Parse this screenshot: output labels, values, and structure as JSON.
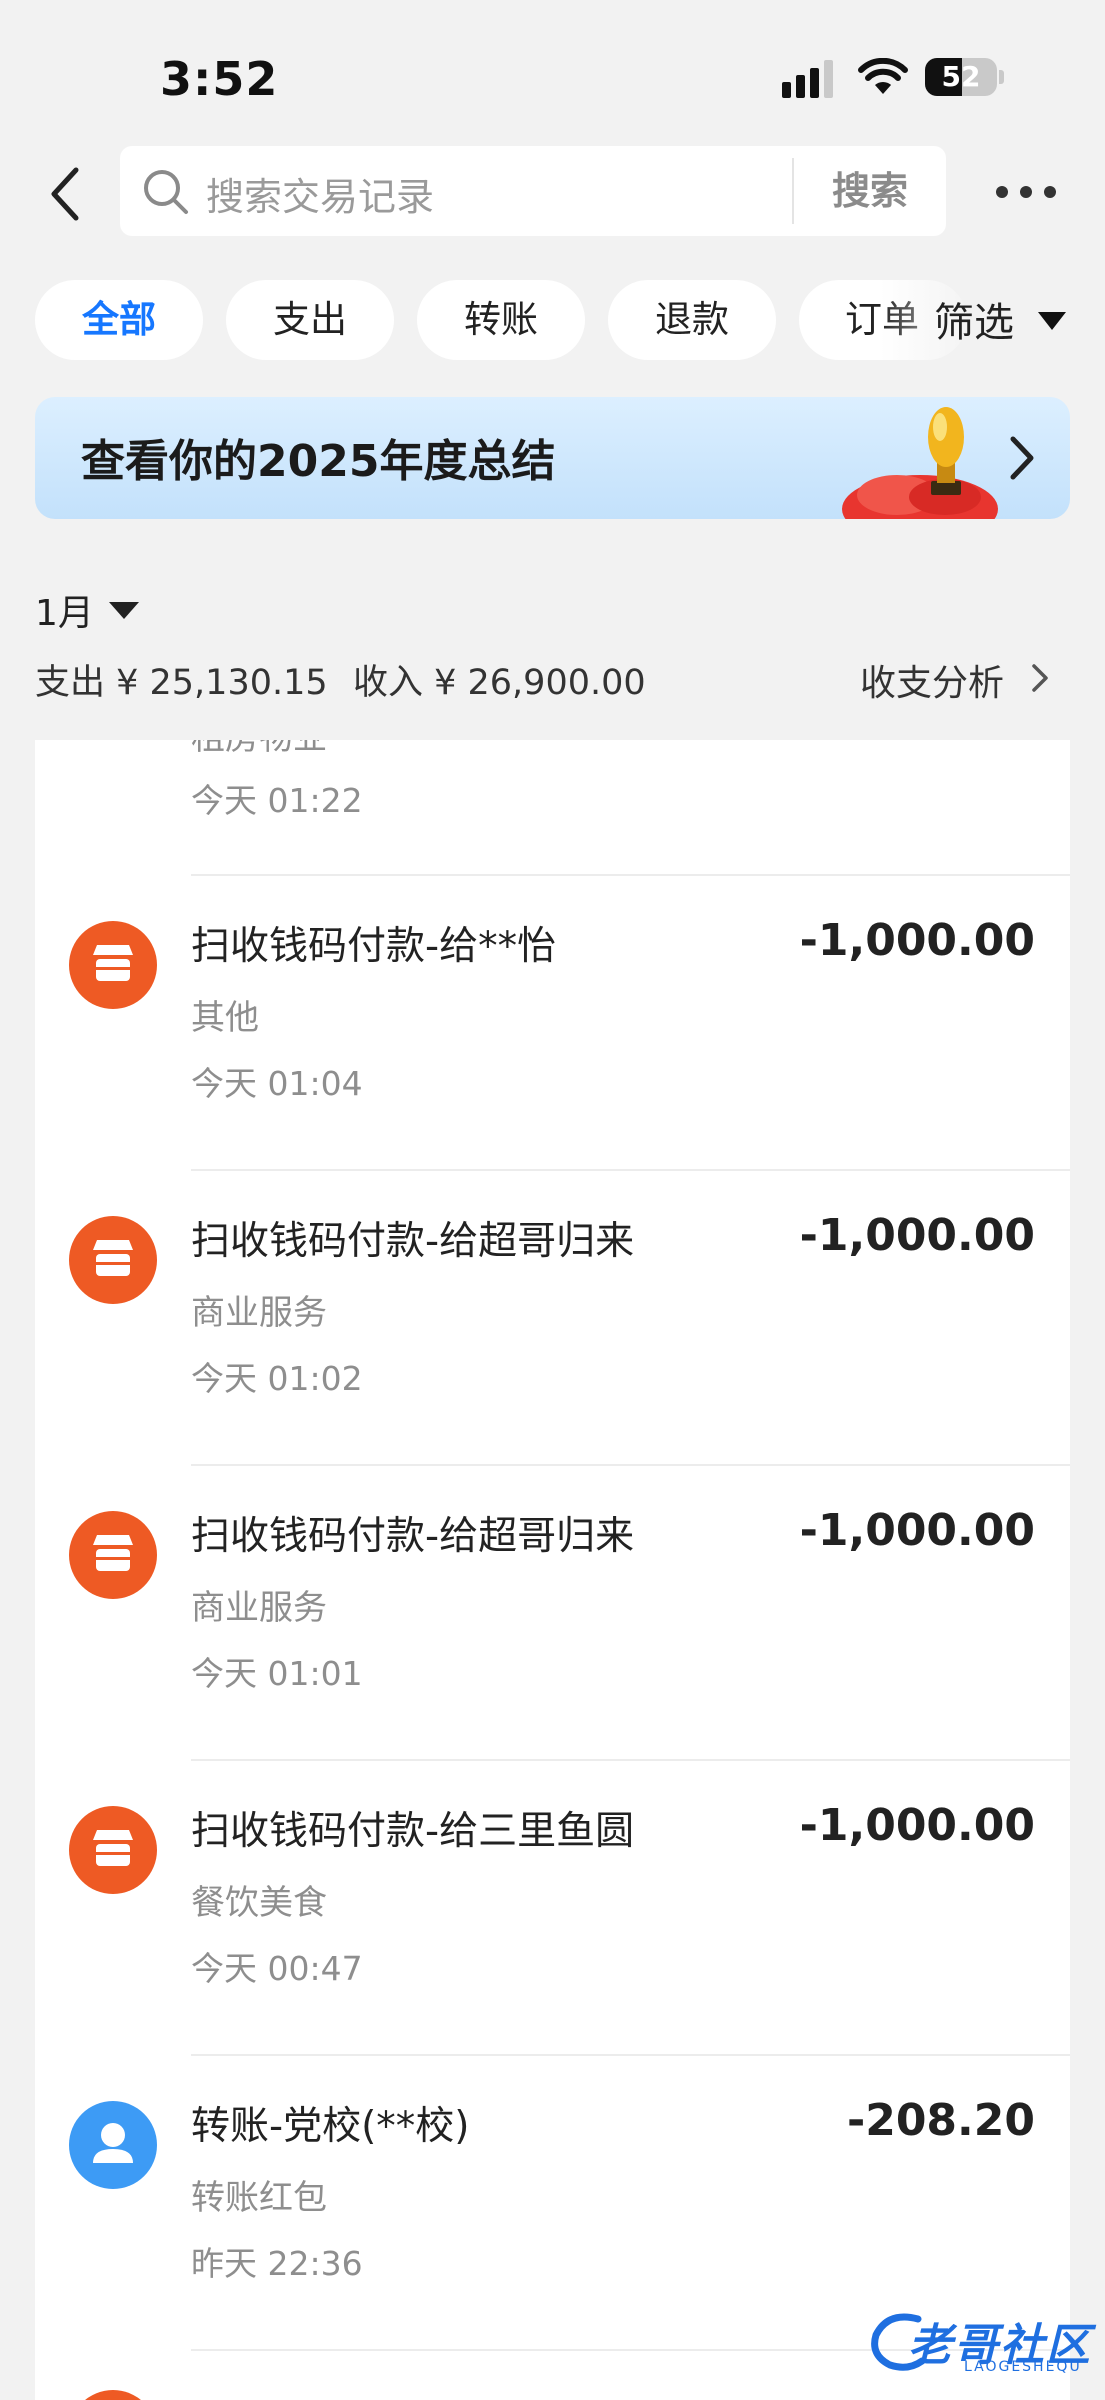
{
  "status_bar": {
    "time": "3:52",
    "battery": "52",
    "battery_level": 0.52
  },
  "header": {
    "search_placeholder": "搜索交易记录",
    "search_button": "搜索"
  },
  "filters": {
    "chips": [
      {
        "label": "全部",
        "active": true
      },
      {
        "label": "支出",
        "active": false
      },
      {
        "label": "转账",
        "active": false
      },
      {
        "label": "退款",
        "active": false
      },
      {
        "label": "订单",
        "active": false
      }
    ],
    "filter_label": "筛选"
  },
  "banner": {
    "text": "查看你的2025年度总结"
  },
  "summary": {
    "month": "1月",
    "expense": "支出 ¥ 25,130.15",
    "income": "收入 ¥ 26,900.00",
    "analysis": "收支分析"
  },
  "partial_item": {
    "category": "租房物业",
    "time": "今天 01:22"
  },
  "transactions": [
    {
      "title": "扫收钱码付款-给**怡",
      "category": "其他",
      "time": "今天 01:04",
      "amount": "-1,000.00",
      "icon": "shop-icon"
    },
    {
      "title": "扫收钱码付款-给超哥归来",
      "category": "商业服务",
      "time": "今天 01:02",
      "amount": "-1,000.00",
      "icon": "shop-icon"
    },
    {
      "title": "扫收钱码付款-给超哥归来",
      "category": "商业服务",
      "time": "今天 01:01",
      "amount": "-1,000.00",
      "icon": "shop-icon"
    },
    {
      "title": "扫收钱码付款-给三里鱼圆",
      "category": "餐饮美食",
      "time": "今天 00:47",
      "amount": "-1,000.00",
      "icon": "shop-icon"
    },
    {
      "title": "转账-党校(**校)",
      "category": "转账红包",
      "time": "昨天 22:36",
      "amount": "-208.20",
      "icon": "person-icon"
    }
  ],
  "watermark": {
    "text": "老哥社区",
    "sub": "LAOGESHEQU"
  },
  "colors": {
    "accent": "#1677ff",
    "shop_icon": "#ee5a24",
    "person_icon": "#3d9bf5"
  }
}
